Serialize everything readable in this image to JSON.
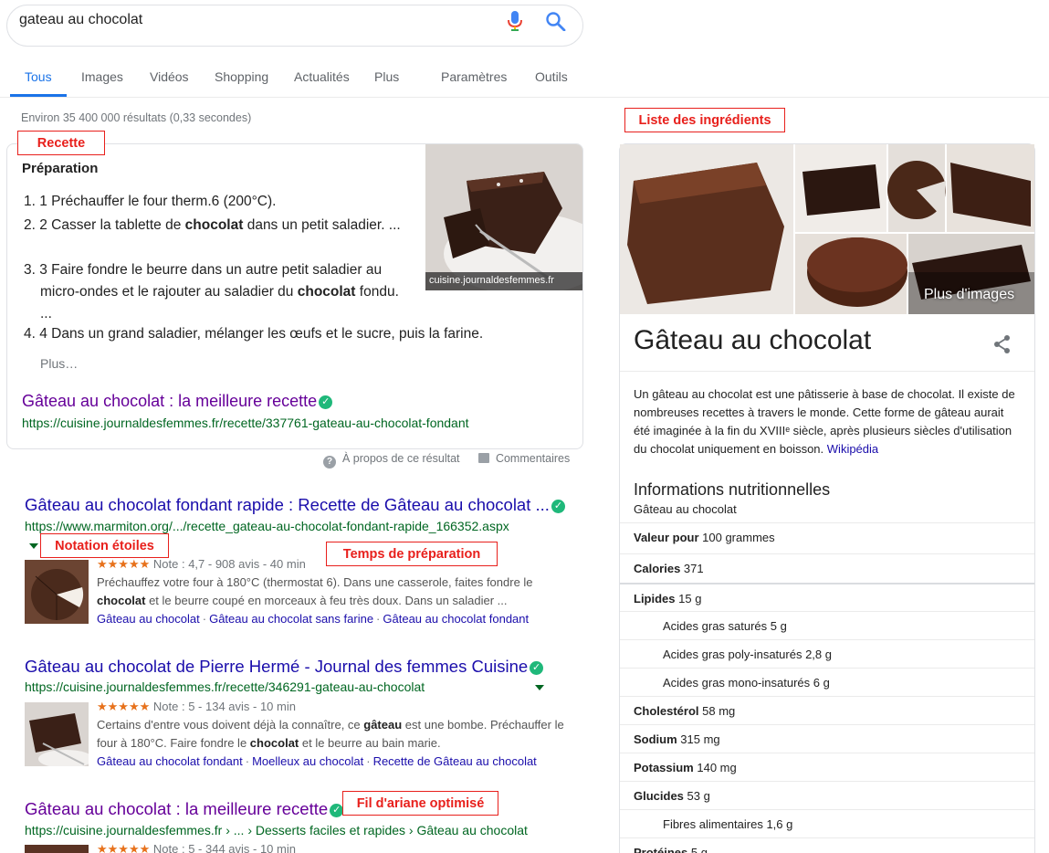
{
  "search": {
    "query": "gateau au chocolat"
  },
  "tabs": [
    "Tous",
    "Images",
    "Vidéos",
    "Shopping",
    "Actualités",
    "Plus",
    "Paramètres",
    "Outils"
  ],
  "stats": "Environ 35 400 000 résultats (0,33 secondes)",
  "annotations": {
    "recette": "Recette",
    "ingredients": "Liste des ingrédients",
    "notation": "Notation étoiles",
    "temps": "Temps de préparation",
    "ariane": "Fil d'ariane optimisé"
  },
  "recipe": {
    "heading": "Préparation",
    "steps": [
      {
        "num": "1.",
        "pre": "1 Préchauffer le four therm.6 (200°C).",
        "bold": "",
        "post": ""
      },
      {
        "num": "2.",
        "pre": "2 Casser la tablette de ",
        "bold": "chocolat",
        "post": " dans un petit saladier. ..."
      },
      {
        "num": "3.",
        "pre": "3 Faire fondre le beurre dans un autre petit saladier au micro-ondes et le rajouter au saladier du ",
        "bold": "chocolat",
        "post": " fondu. ..."
      },
      {
        "num": "4.",
        "pre": "4 Dans un grand saladier, mélanger les œufs et le sucre, puis la farine.",
        "bold": "",
        "post": ""
      }
    ],
    "more": "Plus…",
    "image_caption": "cuisine.journaldesfemmes.fr",
    "title": "Gâteau au chocolat : la meilleure recette",
    "url": "https://cuisine.journaldesfemmes.fr/recette/337761-gateau-au-chocolat-fondant",
    "about": "À propos de ce résultat",
    "feedback": "Commentaires"
  },
  "results": [
    {
      "title": "Gâteau au chocolat fondant rapide : Recette de Gâteau au chocolat ...",
      "url": "https://www.marmiton.org/.../recette_gateau-au-chocolat-fondant-rapide_166352.aspx",
      "stars": "★★★★★",
      "rating": "Note : 4,7 - 908 avis - 40 min",
      "snippet_html": "Préchauffez votre four à 180°C (thermostat 6). Dans une casserole, faites fondre le <b>chocolat</b> et le beurre coupé en morceaux à feu très doux. Dans un saladier ...",
      "sitelinks": [
        "Gâteau au chocolat",
        "Gâteau au chocolat sans farine",
        "Gâteau au chocolat fondant"
      ]
    },
    {
      "title": "Gâteau au chocolat de Pierre Hermé - Journal des femmes Cuisine",
      "url": "https://cuisine.journaldesfemmes.fr/recette/346291-gateau-au-chocolat",
      "stars": "★★★★★",
      "rating": "Note : 5 - 134 avis - 10 min",
      "snippet_html": "Certains d'entre vous doivent déjà la connaître, ce <b>gâteau</b> est une bombe. Préchauffer le four à 180°C. Faire fondre le <b>chocolat</b> et le beurre au bain marie.",
      "sitelinks": [
        "Gâteau au chocolat fondant",
        "Moelleux au chocolat",
        "Recette de Gâteau au chocolat"
      ]
    },
    {
      "title": "Gâteau au chocolat : la meilleure recette",
      "url": "https://cuisine.journaldesfemmes.fr › ... › Desserts faciles et rapides › Gâteau au chocolat",
      "stars": "★★★★★",
      "rating": "Note : 5 - 344 avis - 10 min"
    }
  ],
  "knowledge_panel": {
    "title": "Gâteau au chocolat",
    "more_images": "Plus d'images",
    "description": "Un gâteau au chocolat est une pâtisserie à base de chocolat. Il existe de nombreuses recettes à travers le monde. Cette forme de gâteau aurait été imaginée à la fin du XVIIIᵉ siècle, après plusieurs siècles d'utilisation du chocolat uniquement en boisson.",
    "source": "Wikipédia",
    "nutrition_heading": "Informations nutritionnelles",
    "nutrition_sub": "Gâteau au chocolat",
    "rows": [
      {
        "label": "Valeur pour",
        "value": "100 grammes",
        "indent": false
      },
      {
        "label": "Calories",
        "value": "371",
        "indent": false
      },
      {
        "label": "Lipides",
        "value": "15 g",
        "indent": false
      },
      {
        "label": "Acides gras saturés",
        "value": "5 g",
        "indent": true
      },
      {
        "label": "Acides gras poly-insaturés",
        "value": "2,8 g",
        "indent": true
      },
      {
        "label": "Acides gras mono-insaturés",
        "value": "6 g",
        "indent": true
      },
      {
        "label": "Cholestérol",
        "value": "58 mg",
        "indent": false
      },
      {
        "label": "Sodium",
        "value": "315 mg",
        "indent": false
      },
      {
        "label": "Potassium",
        "value": "140 mg",
        "indent": false
      },
      {
        "label": "Glucides",
        "value": "53 g",
        "indent": false
      },
      {
        "label": "Fibres alimentaires",
        "value": "1,6 g",
        "indent": true
      },
      {
        "label": "Protéines",
        "value": "5 g",
        "indent": false
      }
    ]
  },
  "colors": {
    "accent": "#1a73e8",
    "link": "#1a0dab",
    "visited": "#660099",
    "url": "#006621",
    "annotation": "#e8201c",
    "stars": "#e7711b"
  }
}
